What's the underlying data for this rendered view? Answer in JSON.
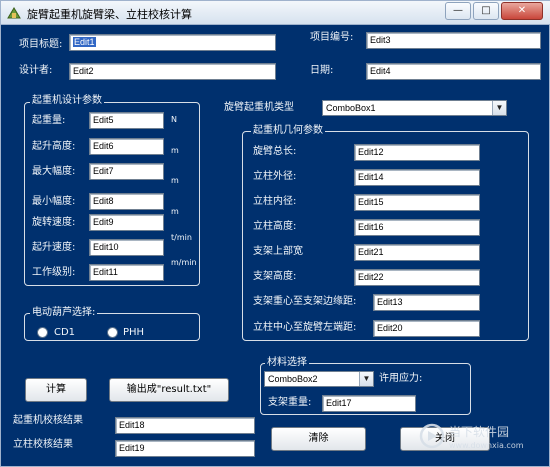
{
  "window": {
    "title": "旋臂起重机旋臂梁、立柱校核计算",
    "minimize_glyph": "—",
    "maximize_glyph": "□",
    "close_glyph": "✕"
  },
  "top_fields": {
    "project_title_label": "项目标题:",
    "project_title_value": "Edit1",
    "project_no_label": "项目编号:",
    "project_no_value": "Edit3",
    "designer_label": "设计者:",
    "designer_value": "Edit2",
    "date_label": "日期:",
    "date_value": "Edit4"
  },
  "crane_params": {
    "title": "起重机设计参数",
    "rows": [
      {
        "label": "起重量:",
        "value": "Edit5",
        "unit": "N"
      },
      {
        "label": "起升高度:",
        "value": "Edit6",
        "unit": "m"
      },
      {
        "label": "最大幅度:",
        "value": "Edit7",
        "unit": "m"
      },
      {
        "label": "最小幅度:",
        "value": "Edit8",
        "unit": "m"
      },
      {
        "label": "旋转速度:",
        "value": "Edit9",
        "unit": "t/min"
      },
      {
        "label": "起升速度:",
        "value": "Edit10",
        "unit": "m/min"
      },
      {
        "label": "工作级别:",
        "value": "Edit11",
        "unit": ""
      }
    ]
  },
  "crane_type": {
    "label": "旋臂起重机类型",
    "value": "ComboBox1"
  },
  "geometry": {
    "title": "起重机几何参数",
    "rows": [
      {
        "label": "旋臂总长:",
        "value": "Edit12"
      },
      {
        "label": "立柱外径:",
        "value": "Edit14"
      },
      {
        "label": "立柱内径:",
        "value": "Edit15"
      },
      {
        "label": "立柱高度:",
        "value": "Edit16"
      },
      {
        "label": "支架上部宽",
        "value": "Edit21"
      },
      {
        "label": "支架高度:",
        "value": "Edit22"
      },
      {
        "label": "支架重心至支架边缘距:",
        "value": "Edit13"
      },
      {
        "label": "立柱中心至旋臂左端距:",
        "value": "Edit20"
      }
    ]
  },
  "hoist": {
    "title": "电动葫芦选择:",
    "options": [
      {
        "label": "CD1",
        "selected": false
      },
      {
        "label": "PHH",
        "selected": false
      }
    ]
  },
  "material": {
    "title": "材料选择",
    "combo_value": "ComboBox2",
    "allow_stress_label": "许用应力:",
    "bracket_weight_label": "支架重量:",
    "bracket_weight_value": "Edit17"
  },
  "actions": {
    "calc_label": "计算",
    "export_label": "输出成\"result.txt\"",
    "clear_label": "清除",
    "close_label": "关闭"
  },
  "results": {
    "crane_check_label": "起重机校核结果",
    "crane_check_value": "Edit18",
    "column_check_label": "立柱校核结果",
    "column_check_value": "Edit19"
  },
  "watermark": {
    "text": "当下软件园",
    "url": "www.downxia.com"
  },
  "colors": {
    "background": "#00306e",
    "label_text": "#f2f6fa",
    "selection": "#3167c5"
  }
}
